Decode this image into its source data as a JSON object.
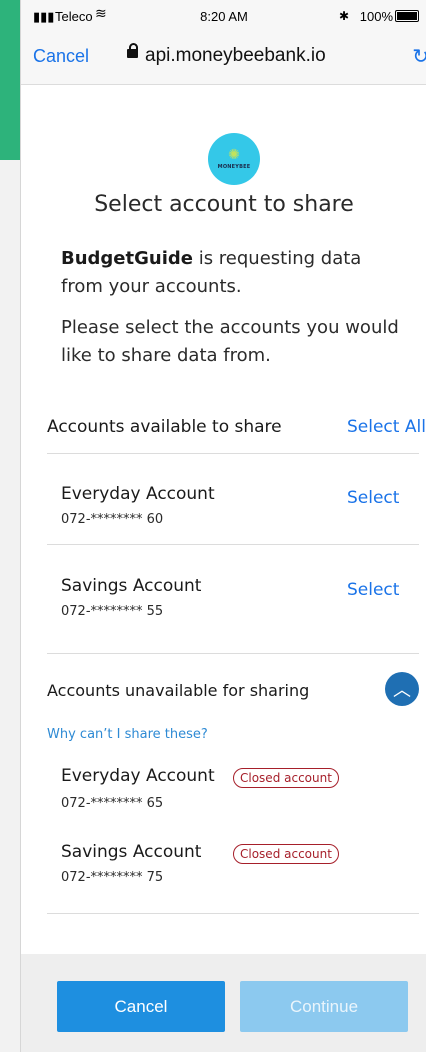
{
  "status_bar": {
    "carrier": "Teleco",
    "time": "8:20 AM",
    "battery": "100%"
  },
  "browser": {
    "cancel_label": "Cancel",
    "url": "api.moneybeebank.io"
  },
  "logo": {
    "text": "MONEYBEE"
  },
  "page": {
    "title": "Select account to share",
    "requester": "BudgetGuide",
    "requesting_text": " is requesting data from your accounts.",
    "instruction": "Please select the accounts you would like to share data from."
  },
  "available": {
    "heading": "Accounts available to share",
    "select_all": "Select All",
    "accounts": [
      {
        "name": "Everyday Account",
        "number": "072-******** 60",
        "action": "Select"
      },
      {
        "name": "Savings Account",
        "number": "072-******** 55",
        "action": "Select"
      }
    ]
  },
  "unavailable": {
    "heading": "Accounts unavailable for sharing",
    "why_link": "Why can’t I share these?",
    "accounts": [
      {
        "name": "Everyday Account",
        "number": "072-******** 65",
        "badge": "Closed account"
      },
      {
        "name": "Savings Account",
        "number": "072-******** 75",
        "badge": "Closed account"
      }
    ]
  },
  "footer": {
    "cancel_label": "Cancel",
    "continue_label": "Continue"
  },
  "colors": {
    "accent": "#1a73e8",
    "primary_button": "#1e8fe0",
    "disabled_button": "#8cc9ef",
    "badge": "#a61f2a",
    "brand_green": "#2db37b",
    "logo_bg": "#34c8e8"
  }
}
